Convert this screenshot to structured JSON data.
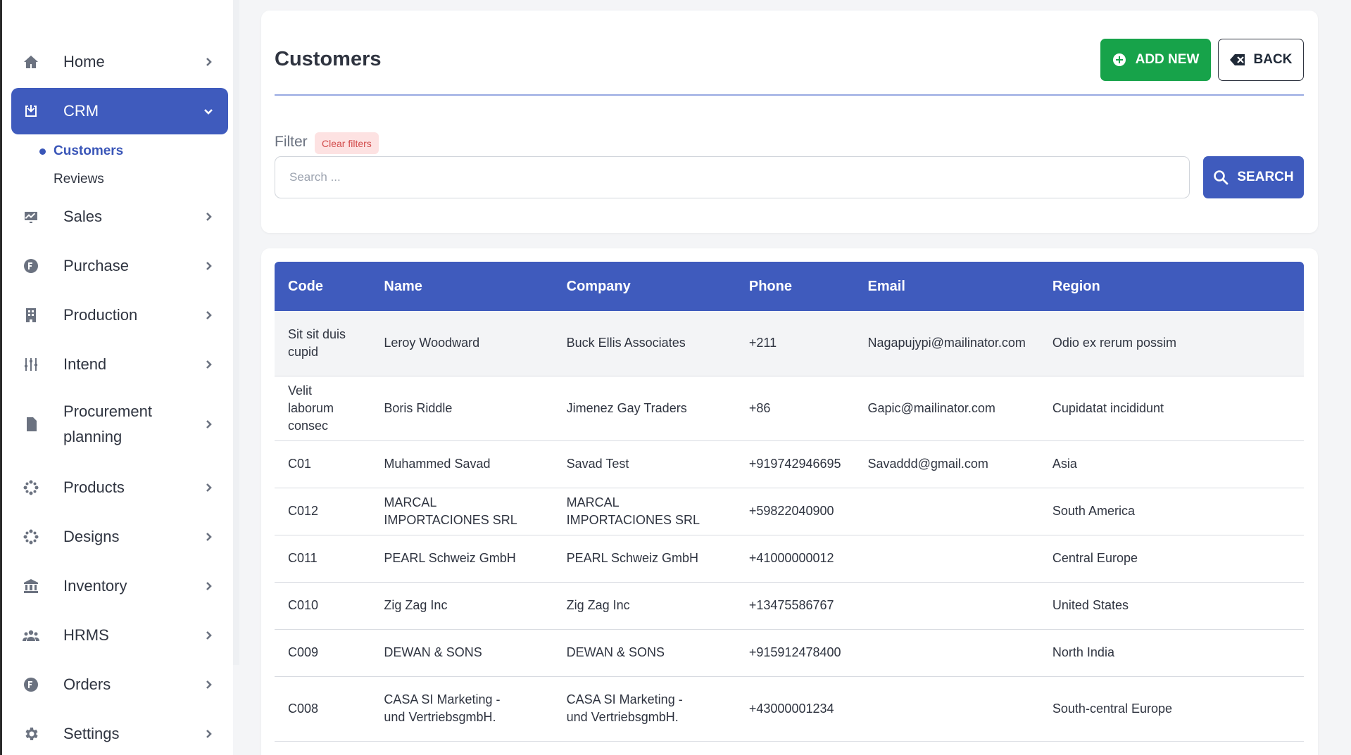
{
  "sidebar": {
    "items": [
      {
        "label": "Home",
        "icon": "home-icon"
      },
      {
        "label": "CRM",
        "icon": "crm-icon"
      },
      {
        "label": "Sales",
        "icon": "sales-icon"
      },
      {
        "label": "Purchase",
        "icon": "purchase-icon"
      },
      {
        "label": "Production",
        "icon": "production-icon"
      },
      {
        "label": "Intend",
        "icon": "sliders-icon"
      },
      {
        "label": "Procurement planning",
        "icon": "procurement-icon"
      },
      {
        "label": "Products",
        "icon": "products-icon"
      },
      {
        "label": "Designs",
        "icon": "designs-icon"
      },
      {
        "label": "Inventory",
        "icon": "inventory-icon"
      },
      {
        "label": "HRMS",
        "icon": "users-icon"
      },
      {
        "label": "Orders",
        "icon": "orders-icon"
      },
      {
        "label": "Settings",
        "icon": "gear-icon"
      }
    ],
    "crm_sub": [
      {
        "label": "Customers"
      },
      {
        "label": "Reviews"
      }
    ]
  },
  "header": {
    "title": "Customers",
    "add_label": "ADD NEW",
    "back_label": "BACK"
  },
  "filter": {
    "label": "Filter",
    "clear_label": "Clear filters",
    "search_placeholder": "Search ...",
    "search_label": "SEARCH"
  },
  "table": {
    "columns": [
      "Code",
      "Name",
      "Company",
      "Phone",
      "Email",
      "Region"
    ],
    "rows": [
      {
        "code": "Sit sit duis cupid",
        "name": "Leroy Woodward",
        "company": "Buck Ellis Associates",
        "phone": "+211",
        "email": "Nagapujypi@mailinator.com",
        "region": "Odio ex rerum possim"
      },
      {
        "code": "Velit laborum consec",
        "name": "Boris Riddle",
        "company": "Jimenez Gay Traders",
        "phone": "+86",
        "email": "Gapic@mailinator.com",
        "region": "Cupidatat incididunt"
      },
      {
        "code": "C01",
        "name": "Muhammed Savad",
        "company": "Savad Test",
        "phone": "+919742946695",
        "email": "Savaddd@gmail.com",
        "region": "Asia"
      },
      {
        "code": "C012",
        "name": "MARCAL IMPORTACIONES SRL",
        "company": "MARCAL IMPORTACIONES SRL",
        "phone": "+59822040900",
        "email": "",
        "region": "South America"
      },
      {
        "code": "C011",
        "name": "PEARL Schweiz GmbH",
        "company": "PEARL Schweiz GmbH",
        "phone": "+41000000012",
        "email": "",
        "region": "Central Europe"
      },
      {
        "code": "C010",
        "name": "Zig Zag Inc",
        "company": "Zig Zag Inc",
        "phone": "+13475586767",
        "email": "",
        "region": "United States"
      },
      {
        "code": "C009",
        "name": "DEWAN & SONS",
        "company": "DEWAN & SONS",
        "phone": "+915912478400",
        "email": "",
        "region": "North India"
      },
      {
        "code": "C008",
        "name": "CASA SI Marketing - und VertriebsgmbH.",
        "company": "CASA SI Marketing - und VertriebsgmbH.",
        "phone": "+43000001234",
        "email": "",
        "region": "South-central Europe"
      }
    ]
  },
  "colors": {
    "primary": "#3f5bbd",
    "success": "#17a34a",
    "clear_badge_bg": "#fde2e2",
    "clear_badge_text": "#d24b4b"
  }
}
